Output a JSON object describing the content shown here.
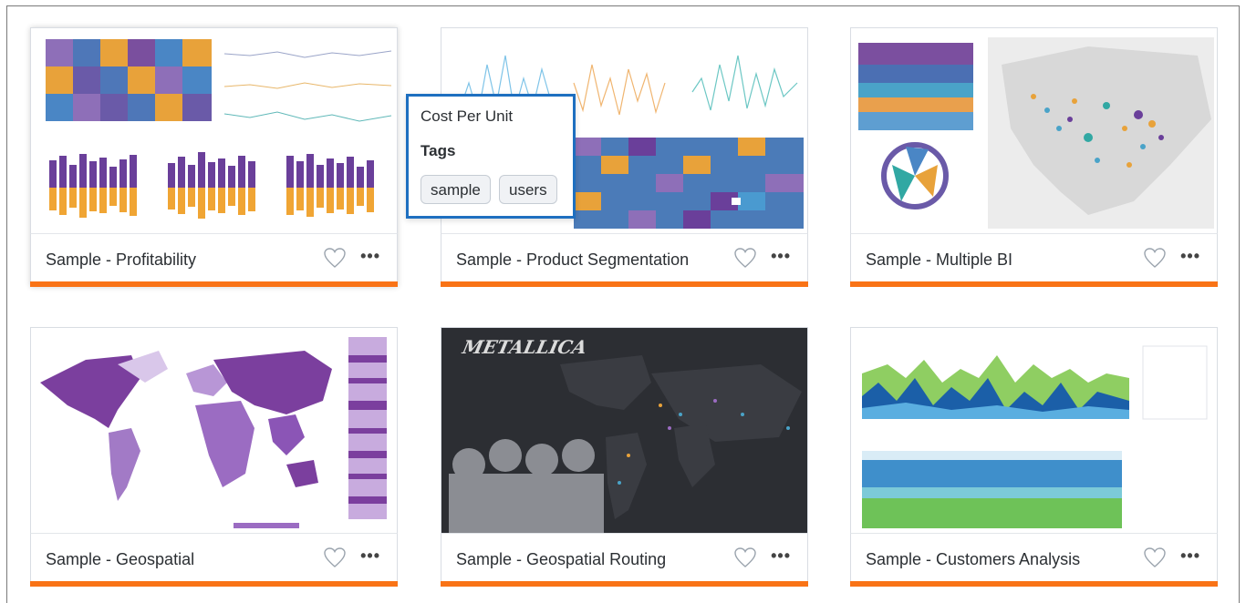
{
  "colors": {
    "accent_bar": "#f97316",
    "tooltip_border": "#1e6fc0"
  },
  "cards": [
    {
      "title": "Sample - Profitability"
    },
    {
      "title": "Sample - Product Segmentation"
    },
    {
      "title": "Sample - Multiple BI"
    },
    {
      "title": "Sample - Geospatial"
    },
    {
      "title": "Sample - Geospatial Routing"
    },
    {
      "title": "Sample - Customers Analysis"
    }
  ],
  "tooltip": {
    "title": "Cost Per Unit",
    "tags_label": "Tags",
    "tags": [
      "sample",
      "users"
    ]
  },
  "icons": {
    "favorite": "heart-outline-icon",
    "more": "ellipsis-icon"
  },
  "more_glyph": "•••"
}
